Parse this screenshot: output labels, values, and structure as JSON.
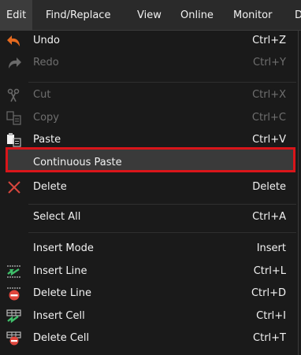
{
  "menubar": {
    "items": [
      "Edit",
      "Find/Replace",
      "View",
      "Online",
      "Monitor",
      "D"
    ]
  },
  "edit_menu": {
    "items": [
      {
        "label": "Undo",
        "shortcut": "Ctrl+Z",
        "icon": "undo-icon",
        "enabled": true
      },
      {
        "label": "Redo",
        "shortcut": "Ctrl+Y",
        "icon": "redo-icon",
        "enabled": false
      },
      {
        "label": "Cut",
        "shortcut": "Ctrl+X",
        "icon": "cut-icon",
        "enabled": false
      },
      {
        "label": "Copy",
        "shortcut": "Ctrl+C",
        "icon": "copy-icon",
        "enabled": false
      },
      {
        "label": "Paste",
        "shortcut": "Ctrl+V",
        "icon": "paste-icon",
        "enabled": true
      },
      {
        "label": "Continuous Paste",
        "shortcut": "",
        "icon": "",
        "enabled": true,
        "highlighted": true
      },
      {
        "label": "Delete",
        "shortcut": "Delete",
        "icon": "delete-x-icon",
        "enabled": true
      },
      {
        "label": "Select All",
        "shortcut": "Ctrl+A",
        "icon": "",
        "enabled": true
      },
      {
        "label": "Insert Mode",
        "shortcut": "Insert",
        "icon": "",
        "enabled": true
      },
      {
        "label": "Insert Line",
        "shortcut": "Ctrl+L",
        "icon": "insert-line-icon",
        "enabled": true
      },
      {
        "label": "Delete Line",
        "shortcut": "Ctrl+D",
        "icon": "delete-line-icon",
        "enabled": true
      },
      {
        "label": "Insert Cell",
        "shortcut": "Ctrl+I",
        "icon": "insert-cell-icon",
        "enabled": true
      },
      {
        "label": "Delete Cell",
        "shortcut": "Ctrl+T",
        "icon": "delete-cell-icon",
        "enabled": true
      }
    ]
  },
  "colors": {
    "highlight_border": "#d9151a",
    "menu_background": "#1a1a1a",
    "disabled_text": "#6f6f6f"
  }
}
